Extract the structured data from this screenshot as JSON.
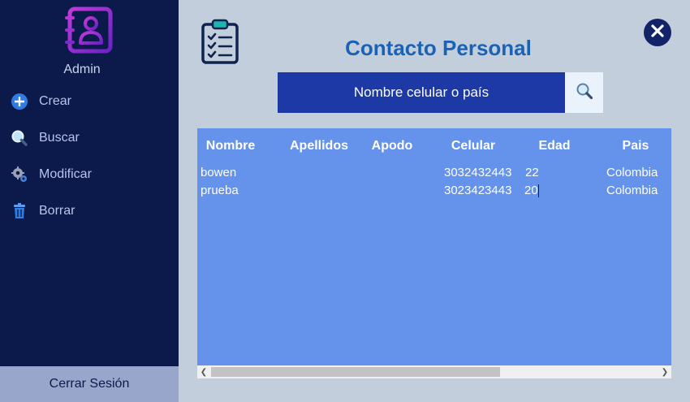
{
  "sidebar": {
    "user_label": "Admin",
    "logo_icon": "user-contact-book-icon",
    "items": [
      {
        "label": "Crear",
        "icon": "plus-circle-icon"
      },
      {
        "label": "Buscar",
        "icon": "search-icon"
      },
      {
        "label": "Modificar",
        "icon": "gear-icon"
      },
      {
        "label": "Borrar",
        "icon": "trash-icon"
      }
    ],
    "logout_label": "Cerrar Sesión"
  },
  "header": {
    "title": "Contacto Personal",
    "clipboard_icon": "clipboard-checklist-icon",
    "close_icon": "close-icon"
  },
  "search": {
    "placeholder": "Nombre celular o país",
    "button_icon": "search-icon"
  },
  "table": {
    "columns": [
      "Nombre",
      "Apellidos",
      "Apodo",
      "Celular",
      "Edad",
      "Pais"
    ],
    "rows": [
      {
        "nombre": "bowen",
        "apellidos": "",
        "apodo": "",
        "celular": "3032432443",
        "edad": "22",
        "pais": "Colombia"
      },
      {
        "nombre": "prueba",
        "apellidos": "",
        "apodo": "",
        "celular": "3023423443",
        "edad": "20",
        "pais": "Colombia"
      }
    ]
  },
  "colors": {
    "sidebar_bg": "#0b1a4a",
    "page_bg": "#c2cedc",
    "title": "#1a62b6",
    "search_bg": "#1c39a6",
    "grid_bg": "#6593eb",
    "logout_bg": "#98a6cc"
  }
}
